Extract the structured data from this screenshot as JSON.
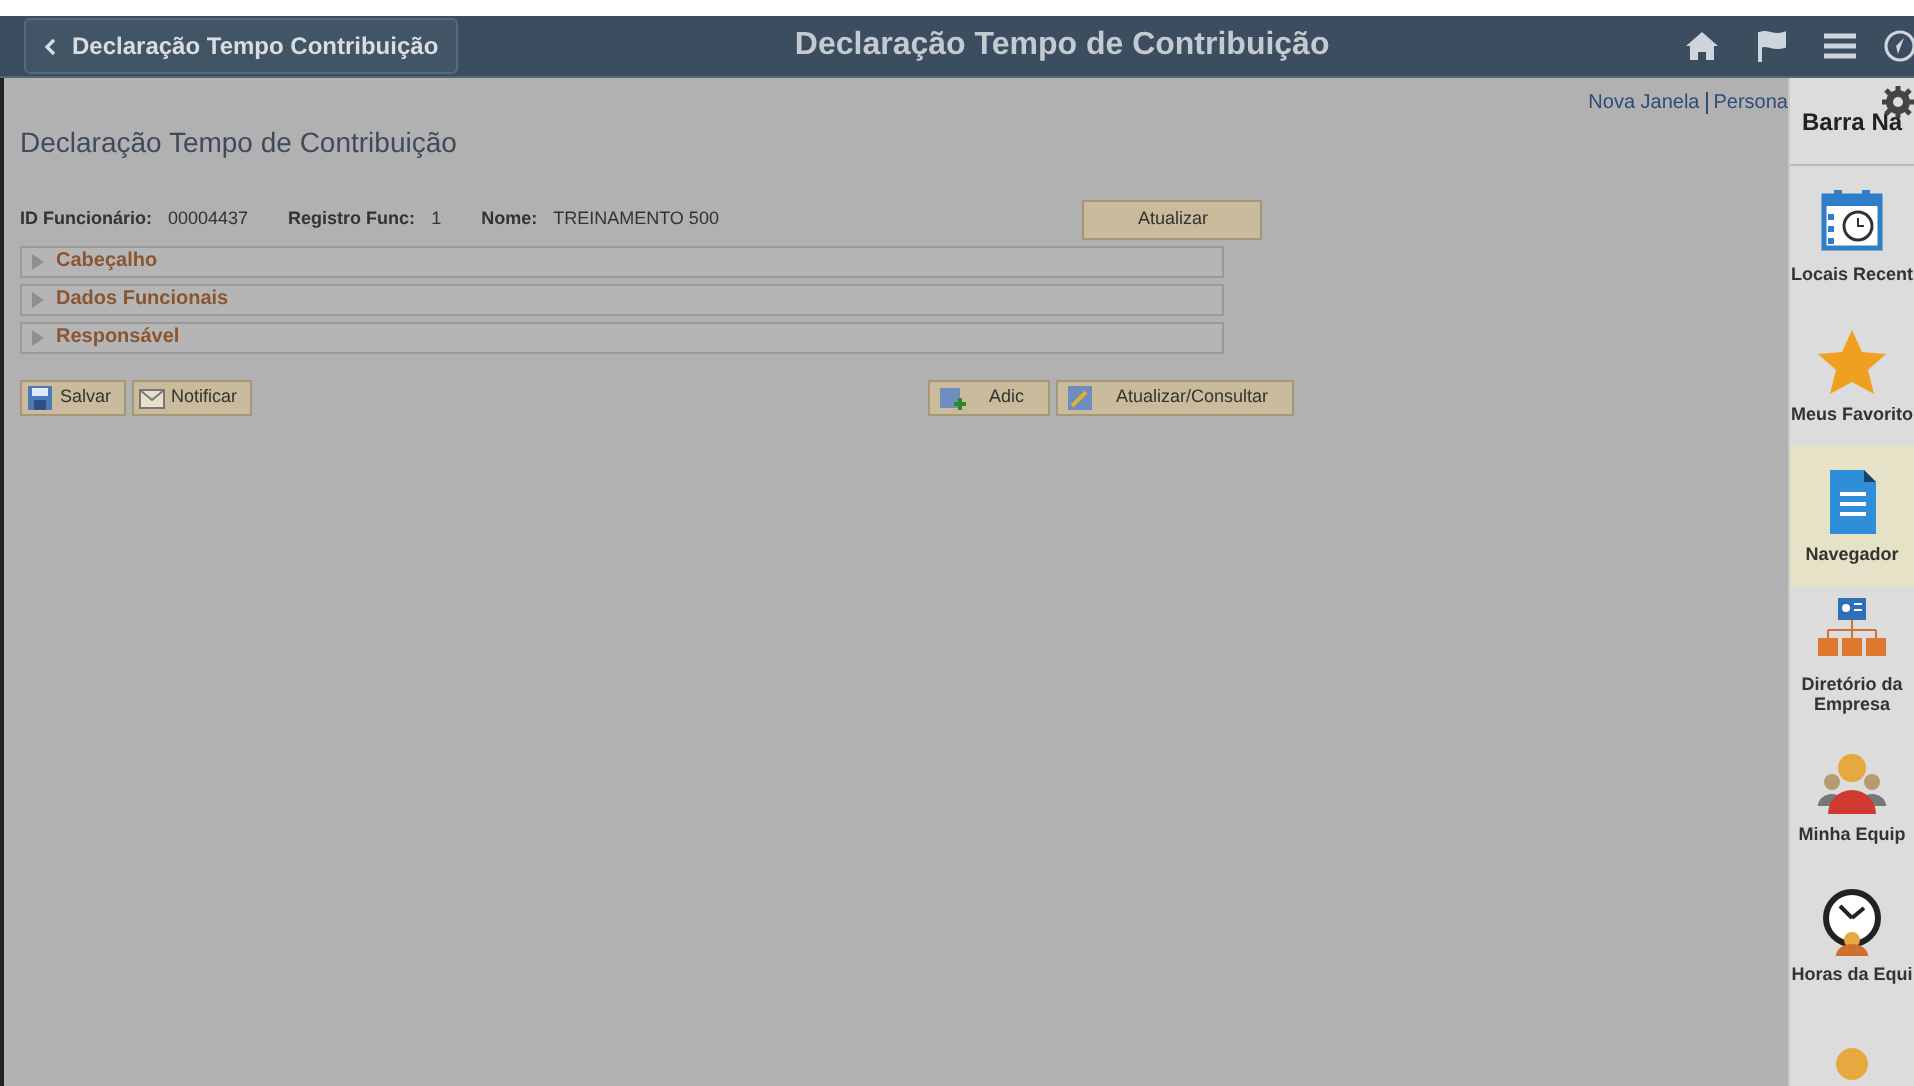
{
  "header": {
    "back_label": "Declaração Tempo Contribuição",
    "title": "Declaração Tempo de Contribuição"
  },
  "links": [
    "Nova Janela",
    "Persona"
  ],
  "page_title": "Declaração Tempo de Contribuição",
  "fields": [
    {
      "label": "ID Funcionário:",
      "value": "00004437"
    },
    {
      "label": "Registro Func:",
      "value": "1"
    },
    {
      "label": "Nome:",
      "value": "TREINAMENTO 500"
    }
  ],
  "refresh_button": "Atualizar",
  "sections": [
    {
      "label": "Cabeçalho",
      "expanded": false
    },
    {
      "label": "Dados Funcionais",
      "expanded": false
    },
    {
      "label": "Responsável",
      "expanded": false
    }
  ],
  "left_buttons": [
    {
      "kind": "save",
      "label": "Salvar"
    },
    {
      "kind": "notify",
      "label": "Notificar"
    }
  ],
  "right_buttons": [
    {
      "kind": "add",
      "label": "Adic"
    },
    {
      "kind": "update",
      "label": "Atualizar/Consultar"
    }
  ],
  "nav_bar": {
    "title": "Barra Na",
    "items": [
      {
        "kind": "recent",
        "label": "Locais Recent",
        "selected": false
      },
      {
        "kind": "favorites",
        "label": "Meus Favorito",
        "selected": false
      },
      {
        "kind": "navigator",
        "label": "Navegador",
        "selected": true
      },
      {
        "kind": "directory",
        "label": "Diretório da Empresa",
        "selected": false
      },
      {
        "kind": "team",
        "label": "Minha Equip",
        "selected": false
      },
      {
        "kind": "hours",
        "label": "Horas da Equi",
        "selected": false
      },
      {
        "kind": "person",
        "selected": false
      }
    ]
  }
}
